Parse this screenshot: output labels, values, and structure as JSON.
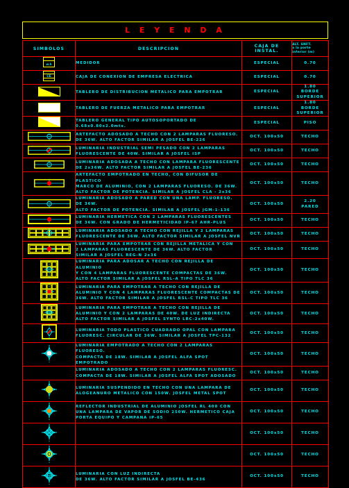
{
  "title": {
    "text": "L E Y E N D A"
  },
  "colors": {
    "background": "#000000",
    "border_red": "#ff0000",
    "border_yellow": "#ffff00",
    "text_cyan": "#00e5ee",
    "title_red": "#ff0000",
    "accent_red_fill": "#ff0000",
    "accent_green_fill": "#ccdd22",
    "accent_orange_fill": "#ff8800"
  },
  "table": {
    "headers": {
      "symbols": "SIMBOLOS",
      "description": "DESCRIPCION",
      "box": "CAJA DE INSTAL.",
      "height": "ALT. SNFT.\na la parte\ninferior (m)"
    },
    "rows": [
      {
        "symbol": "watt-hour-meter-box-icon",
        "description": "MEDIDOR",
        "box": "ESPECIAL",
        "height": "0.70"
      },
      {
        "symbol": "electric-company-connection-box-icon",
        "description": "CAJA DE CONEXION DE EMPRESA ELECTRICA",
        "box": "ESPECIAL",
        "height": "0.70"
      },
      {
        "symbol": "distribution-panel-icon",
        "description": "TABLERO DE DISTRIBUCION METALICO PARA EMPOTRAR",
        "box": "ESPECIAL",
        "height": "1.80\nBORDE\nSUPERIOR"
      },
      {
        "symbol": "power-panel-icon",
        "description": "TABLERO DE FUERZA METALICO PARA EMPOTRAR",
        "box": "ESPECIAL",
        "height": "1.80\nBORDE\nSUPERIOR"
      },
      {
        "symbol": "general-panel-icon",
        "description": "TABLERO GENERAL TIPO AUTOSOPORTADO DE 0.68x0.80x2.0mts.",
        "box": "ESPECIAL",
        "height": "PISO"
      },
      {
        "symbol": "surface-linear-2lamp-icon",
        "description": "ARTEFACTO ADOSADO A TECHO CON 2 LAMPARAS FLUORESO.\nDE 36W. ALTO FACTOR SIMILAR A JOSFEL BE-226",
        "box": "OCT. 100x50",
        "height": "TECHO"
      },
      {
        "symbol": "industrial-linear-2lamp-icon",
        "description": "LUMINARIA INDUSTRIAL SEMI PESADO CON 2 LAMPARAS\nFLUORESCENTE DE 40W. SIMILAR A JOSFEL ISP",
        "box": "OCT. 100x50",
        "height": "TECHO"
      },
      {
        "symbol": "surface-linear-1lamp-icon",
        "description": "LUMINARIA ADOSADA A TECHO CON LAMPARA FLUORESCENTE\nDE 2x36W. ALTO FACTOR SIMILAR A JOSFEL BE-236",
        "box": "OCT. 100x50",
        "height": "TECHO"
      },
      {
        "symbol": "recessed-linear-diffuser-icon",
        "description": "ARTEFACTO EMPOTRADO EN TECHO, CON DIFUSOR DE PLASTICO\nMARCO DE ALUMINIO, CON 2 LAMPARAS FLUORESO. DE 36W.\nALTO FACTOR DE POTENCIA. SIMILAR A JOSFEL CLA - 2x36",
        "box": "OCT. 100x50",
        "height": "TECHO"
      },
      {
        "symbol": "wall-mounted-linear-icon",
        "description": "LUMINARIA ADOSADO A PARED CON UNA LAMP. FLUORESO. DE 36W.\nALTO FACTOR DE POTENCIA. SIMILAR A JOSFEL JGM-1-136",
        "box": "OCT. 100x50",
        "height": "2.20\nPARED"
      },
      {
        "symbol": "hermetic-linear-2lamp-icon",
        "description": "LUMINARIA HERMETICA CON 2 LAMPARAS FLUORESCENTES\nDE 36W. CON GRADO DE HERMETICIDAD IP-67 AHR-PLUS",
        "box": "OCT. 100x50",
        "height": "TECHO"
      },
      {
        "symbol": "surface-louver-2lamp-icon",
        "description": "LUMINARIA ADOSADO A TECHO CON REJILLA Y 2 LAMPARAS\nFLUORESCENTE DE 36W. ALTO FACTOR SIMILAR A JOSFEL NVR",
        "box": "OCT. 100x50",
        "height": "TECHO"
      },
      {
        "symbol": "recessed-metal-louver-icon",
        "description": "LUMINARIA PARA EMPOTRAR CON REJILLA METALICA Y CON\n2 LAMPARAS FLUORESCENTE DE 36W. ALTO FACTOR\nSIMILAR A JOSFEL REG-N 2x36",
        "box": "OCT. 100x50",
        "height": "TECHO"
      },
      {
        "symbol": "surface-square-louver-4lamp-icon",
        "description": "LUMINARIA PARA ADOSAR A TECHO CON REJILLA DE ALUMINIO\nY CON 4 LAMPARAS FLUORESCENTE COMPACTAS DE 36W.\nALTO FACTOR SIMILAR A JOSFEL RSL-A TIPO TLC 36",
        "box": "OCT. 100x50",
        "height": "TECHO"
      },
      {
        "symbol": "recessed-square-louver-4lamp-icon",
        "description": "LUMINARIA PARA EMPOTRAR A TECHO CON REJILLA DE\nALUMINIO Y CON 4 LAMPARAS FLUORESCENTE COMPACTAS DE\n36W. ALTO FACTOR SIMILAR A JOSFEL RSL-C TIPO TLC 36",
        "box": "OCT. 100x50",
        "height": "TECHO"
      },
      {
        "symbol": "recessed-square-indirect-icon",
        "description": "LUMINARIA PARA EMPOTRAR A TECHO CON REJILLA DE\nALUMINIO Y CON 2 LAMPARAS DE 40W. DE LUZ INDIRECTA\nALTO FACTOR SIMILAR A JOSFEL SYNTO LRC-2x40W.",
        "box": "OCT. 100x50",
        "height": "TECHO"
      },
      {
        "symbol": "square-opal-plastic-icon",
        "description": "LUMINARIA TODO PLASTICO CUADRADO OPAL CON LAMPARA\nFLUORESC. CIRCULAR DE 36W. SIMILAR A JOSFEL TPC-132",
        "box": "OCT. 100x50",
        "height": "TECHO"
      },
      {
        "symbol": "recessed-spot-compact-icon",
        "description": "LUMINARIA EMPOTRADO A TECHO CON 2 LAMPARAS FLUORESO.\nCOMPACTA DE 18W. SIMILAR A JOSFEL ALFA SPOT EMPOTRADO",
        "box": "OCT. 100x50",
        "height": "TECHO"
      },
      {
        "symbol": "blank-symbol",
        "description": "LUMINARIA ADOSADO A TECHO CON 2 LAMPARAS FLUORESC.\nCOMPACTA DE 18W. SIMILAR A JOSFEL ALFA SPOT ADOSADO",
        "box": "OCT. 100x50",
        "height": "TECHO"
      },
      {
        "symbol": "suspended-metal-halide-icon",
        "description": "LUMINARIA SUSPENDIDO EN TECHO CON UNA LAMPARA DE\nALOGEANURO METALICO CON 150W. JOSFEL METAL SPOT",
        "box": "OCT. 100x50",
        "height": "TECHO"
      },
      {
        "symbol": "industrial-reflector-icon",
        "description": "REFLECTOR INDUSTRIAL DE ALUMINIO JOSFEL RL 400 CON\nUNA LAMPARA DE VAPOR DE SODIO 250W. HERMETICO CAJA\nPORTA EQUIPO Y CAMPANA IP-65",
        "box": "OCT. 100x50",
        "height": "TECHO"
      },
      {
        "symbol": "crossed-circle-icon",
        "description": "",
        "box": "OCT. 100x50",
        "height": "TECHO"
      },
      {
        "symbol": "yellow-ring-circle-icon",
        "description": "",
        "box": "OCT. 100x50",
        "height": "TECHO"
      },
      {
        "symbol": "indirect-light-square-icon",
        "description": "LUMINARIA CON LUZ INDIRECTA\nDE 36W. ALTO FACTOR SIMILAR A JOSFEL BE-436",
        "box": "OCT. 100x50",
        "height": "TECHO"
      }
    ]
  }
}
